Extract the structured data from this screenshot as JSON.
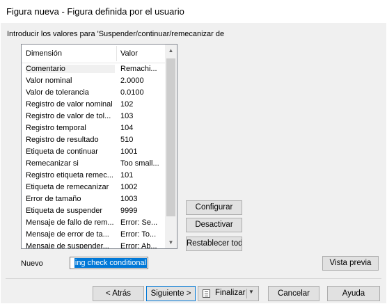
{
  "window": {
    "title": "Figura nueva - Figura definida por el usuario"
  },
  "intro_text": "Introducir los valores para 'Suspender/continuar/remecanizar de",
  "table": {
    "columns": [
      "Dimensión",
      "Valor"
    ],
    "rows": [
      {
        "name": "Comentario",
        "value": "Remachi..."
      },
      {
        "name": "Valor nominal",
        "value": "2.0000"
      },
      {
        "name": "Valor de tolerancia",
        "value": "0.0100"
      },
      {
        "name": "Registro de valor nominal",
        "value": "102"
      },
      {
        "name": "Registro de valor de tol...",
        "value": "103"
      },
      {
        "name": "Registro temporal",
        "value": "104"
      },
      {
        "name": "Registro de resultado",
        "value": "510"
      },
      {
        "name": "Etiqueta de continuar",
        "value": "1001"
      },
      {
        "name": "Remecanizar si",
        "value": "Too small..."
      },
      {
        "name": "Registro etiqueta remec...",
        "value": "101"
      },
      {
        "name": "Etiqueta de remecanizar",
        "value": "1002"
      },
      {
        "name": "Error de tamaño",
        "value": "1003"
      },
      {
        "name": "Etiqueta de suspender",
        "value": "9999"
      },
      {
        "name": "Mensaje de fallo de rem...",
        "value": "Error: Se..."
      },
      {
        "name": "Mensaje de error de ta...",
        "value": "Error: To..."
      },
      {
        "name": "Mensaje de suspender...",
        "value": "Error: Ab..."
      }
    ]
  },
  "side_buttons": {
    "configurar": "Configurar",
    "desactivar": "Desactivar",
    "restablecer": "Restablecer todo"
  },
  "nuevo": {
    "label": "Nuevo",
    "value": "ing check conditional"
  },
  "vista_previa": "Vista previa",
  "footer": {
    "atras": "< Atrás",
    "siguiente": "Siguiente >",
    "finalizar": "Finalizar",
    "cancelar": "Cancelar",
    "ayuda": "Ayuda"
  },
  "icons": {
    "scroll_up": "scroll-up-arrow-icon",
    "scroll_down": "scroll-down-arrow-icon",
    "finalizar": "document-list-icon",
    "dropdown": "chevron-down-icon"
  },
  "colors": {
    "selection": "#0078d7",
    "focus_border": "#0078d7",
    "button_face": "#e1e1e1",
    "dialog_bg": "#f0f0f0"
  }
}
